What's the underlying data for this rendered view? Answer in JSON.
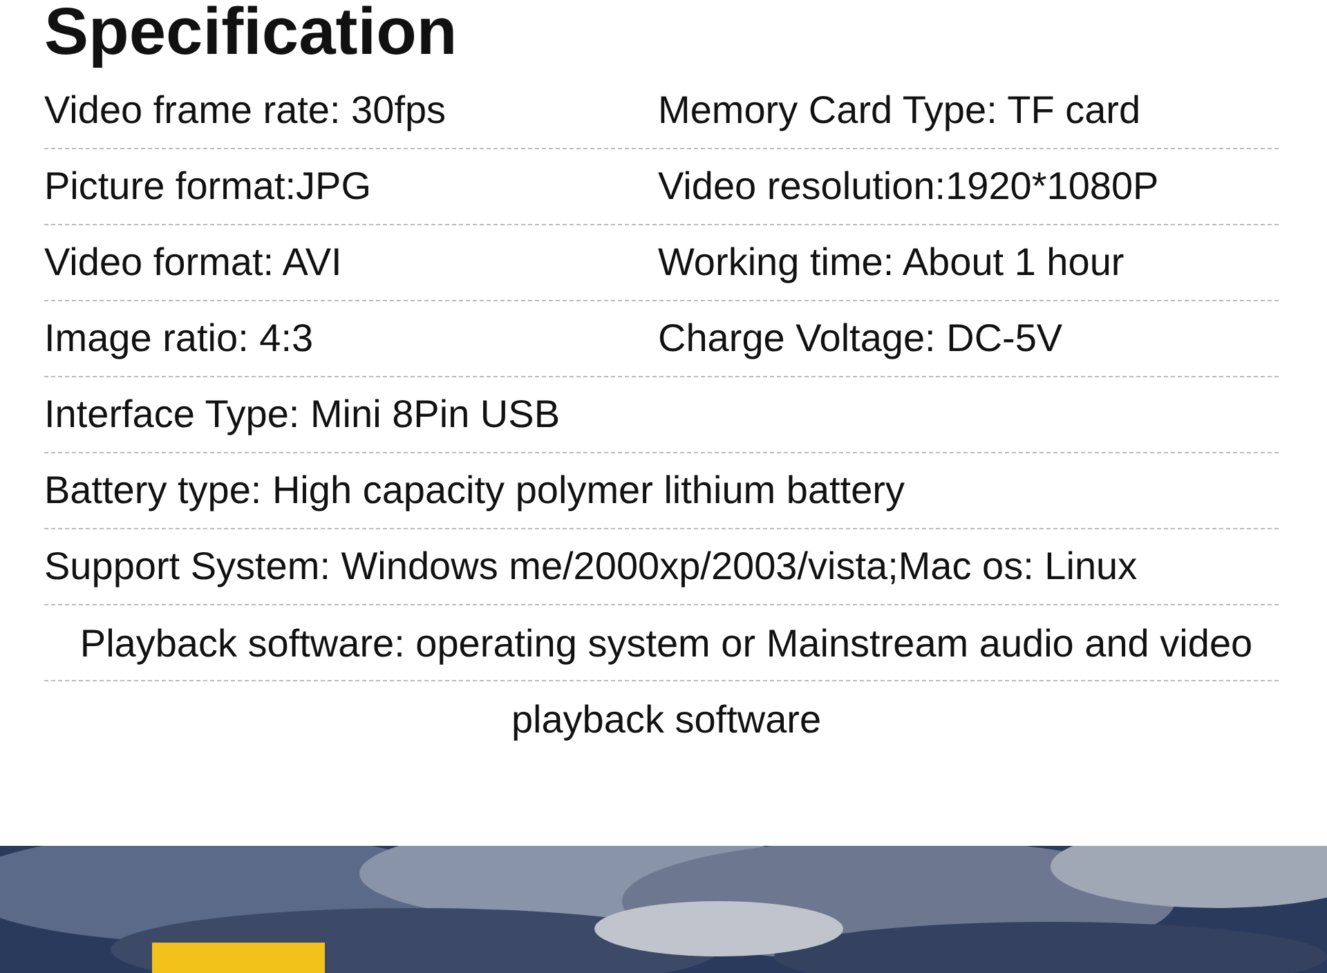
{
  "title": "Specification",
  "rows": [
    {
      "kind": "pair",
      "items": [
        "Video frame rate: 30fps",
        "Memory Card Type: TF card"
      ]
    },
    {
      "kind": "pair",
      "items": [
        "Picture format:JPG",
        "Video resolution:1920*1080P"
      ]
    },
    {
      "kind": "pair",
      "items": [
        "Video format: AVI",
        "Working time: About 1 hour"
      ]
    },
    {
      "kind": "pair",
      "items": [
        "Image ratio: 4:3",
        "Charge Voltage: DC-5V"
      ]
    },
    {
      "kind": "single",
      "items": [
        "Interface Type: Mini 8Pin USB"
      ]
    },
    {
      "kind": "single",
      "items": [
        "Battery type: High capacity polymer lithium battery"
      ]
    },
    {
      "kind": "single",
      "items": [
        "Support System: Windows me/2000xp/2003/vista;Mac os: Linux"
      ]
    },
    {
      "kind": "wrap",
      "items": [
        "Playback software: operating system or Mainstream audio and video playback software"
      ]
    }
  ]
}
